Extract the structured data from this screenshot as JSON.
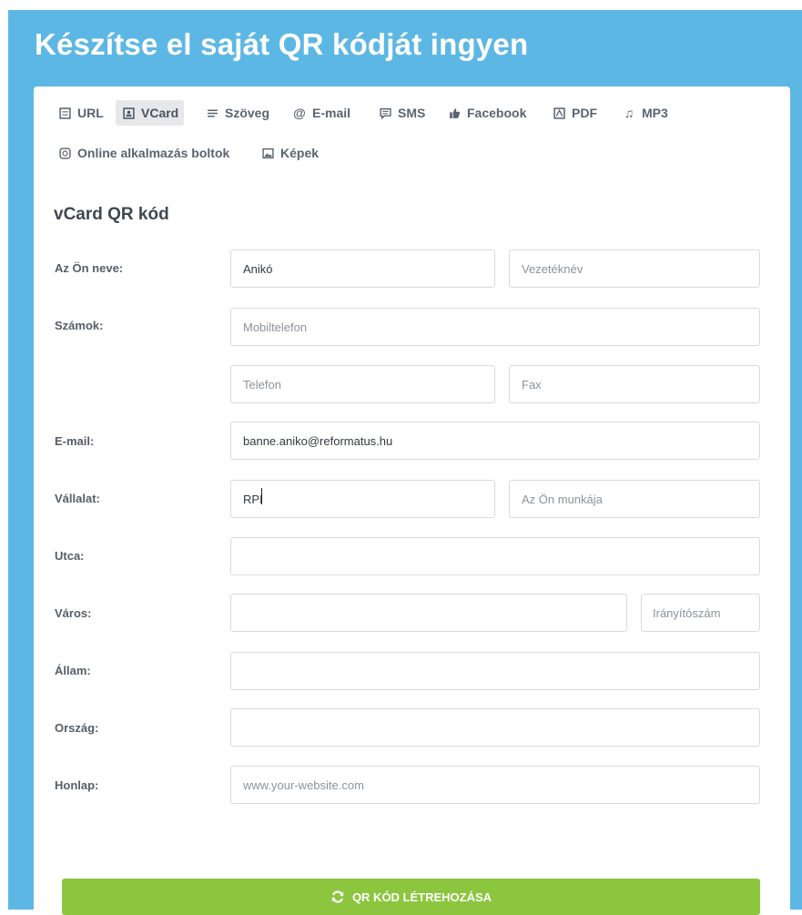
{
  "header": {
    "title": "Készítse el saját QR kódját ingyen"
  },
  "tabs": [
    {
      "label": "URL",
      "icon": "document-icon",
      "active": false
    },
    {
      "label": "VCard",
      "icon": "contact-card-icon",
      "active": true
    },
    {
      "label": "Szöveg",
      "icon": "text-lines-icon",
      "active": false
    },
    {
      "label": "E-mail",
      "icon": "at-sign-icon",
      "active": false
    },
    {
      "label": "SMS",
      "icon": "chat-bubble-icon",
      "active": false
    },
    {
      "label": "Facebook",
      "icon": "thumbs-up-icon",
      "active": false
    },
    {
      "label": "PDF",
      "icon": "pdf-icon",
      "active": false
    },
    {
      "label": "MP3",
      "icon": "music-note-icon",
      "active": false
    },
    {
      "label": "Online alkalmazás boltok",
      "icon": "app-store-icon",
      "active": false
    },
    {
      "label": "Képek",
      "icon": "image-icon",
      "active": false
    }
  ],
  "form": {
    "title": "vCard QR kód",
    "labels": {
      "name": "Az Ön neve:",
      "numbers": "Számok:",
      "email": "E-mail:",
      "company": "Vállalat:",
      "street": "Utca:",
      "city": "Város:",
      "state": "Állam:",
      "country": "Ország:",
      "website": "Honlap:"
    },
    "fields": {
      "first_name": {
        "value": "Anikó",
        "placeholder": ""
      },
      "last_name": {
        "value": "",
        "placeholder": "Vezetéknév"
      },
      "mobile": {
        "value": "",
        "placeholder": "Mobiltelefon"
      },
      "phone": {
        "value": "",
        "placeholder": "Telefon"
      },
      "fax": {
        "value": "",
        "placeholder": "Fax"
      },
      "email": {
        "value": "banne.aniko@reformatus.hu",
        "placeholder": ""
      },
      "company": {
        "value": "RPI",
        "placeholder": ""
      },
      "job": {
        "value": "",
        "placeholder": "Az Ön munkája"
      },
      "street": {
        "value": "",
        "placeholder": ""
      },
      "city": {
        "value": "",
        "placeholder": ""
      },
      "zip": {
        "value": "",
        "placeholder": "Irányítószám"
      },
      "state": {
        "value": "",
        "placeholder": ""
      },
      "country": {
        "value": "",
        "placeholder": ""
      },
      "website": {
        "value": "",
        "placeholder": "www.your-website.com"
      }
    }
  },
  "submit": {
    "label": "QR KÓD LÉTREHOZÁSA",
    "icon": "refresh-icon",
    "color": "#8cc63f"
  },
  "colors": {
    "background": "#5db7e4",
    "accent": "#8cc63f"
  }
}
